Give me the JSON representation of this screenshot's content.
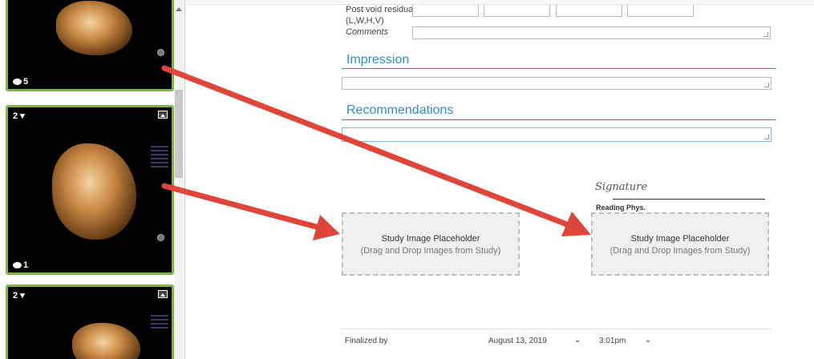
{
  "thumbnails": [
    {
      "comment_count": "5"
    },
    {
      "series_number": "2 ▾",
      "comment_count": "1"
    },
    {
      "series_number": "2 ▾"
    }
  ],
  "form": {
    "post_void_label": "Post void residual",
    "post_void_sublabel": "(L,W,H,V)",
    "comments_label": "Comments",
    "impression_title": "Impression",
    "recommendations_title": "Recommendations",
    "signature_text": "Signature",
    "reading_phys_label": "Reading Phys.",
    "placeholder_title": "Study Image Placeholder",
    "placeholder_hint": "(Drag and Drop Images from Study)",
    "finalized_by_label": "Finalized by",
    "finalized_date": "August 13, 2019",
    "finalized_time": "3:01pm"
  },
  "colors": {
    "accent": "#2e8fc8",
    "thumb_border": "#7bb54a",
    "arrow": "#e0453a"
  }
}
